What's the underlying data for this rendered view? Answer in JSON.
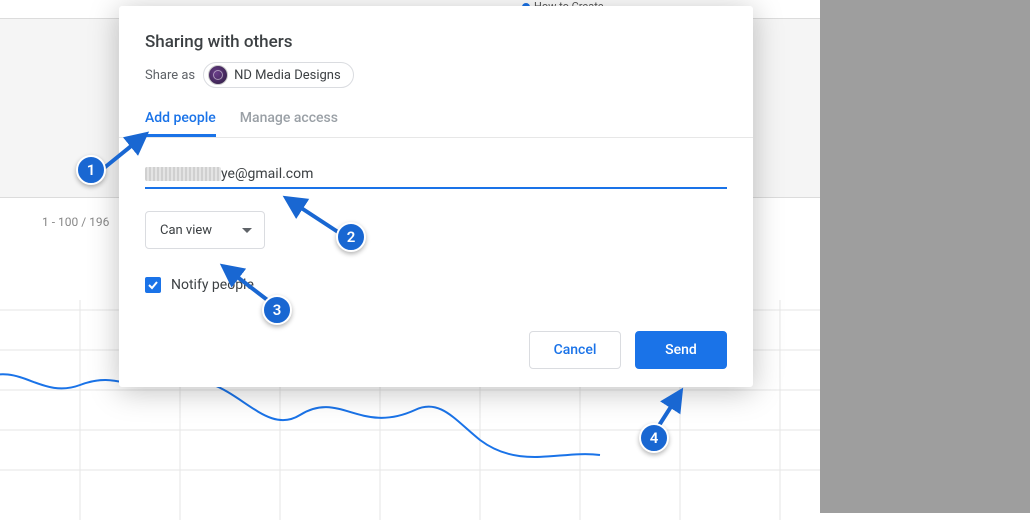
{
  "background": {
    "legend_label": "How to Create",
    "pagination": "1 - 100 / 196"
  },
  "modal": {
    "title": "Sharing with others",
    "share_as_label": "Share as",
    "share_as_name": "ND Media Designs",
    "tabs": {
      "add_people": "Add people",
      "manage_access": "Manage access"
    },
    "email_suffix": "ye@gmail.com",
    "permission": "Can view",
    "notify_label": "Notify people",
    "notify_checked": true,
    "cancel_label": "Cancel",
    "send_label": "Send"
  },
  "callouts": {
    "c1": "1",
    "c2": "2",
    "c3": "3",
    "c4": "4"
  }
}
